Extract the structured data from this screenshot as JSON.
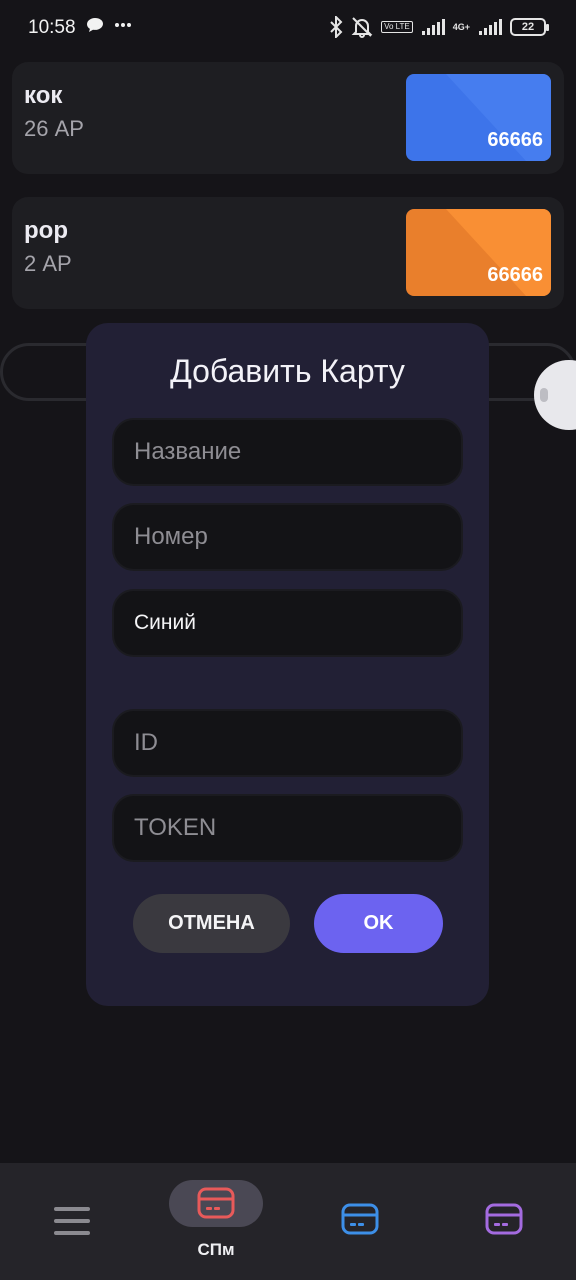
{
  "status_bar": {
    "time": "10:58",
    "network": "4G+",
    "lte": "Vo LTE",
    "battery": "22"
  },
  "cards": [
    {
      "name": "кок",
      "balance": "26 АР",
      "number": "66666",
      "color": "#3d74ea"
    },
    {
      "name": "рор",
      "balance": "2 АР",
      "number": "66666",
      "color": "#f4832f"
    }
  ],
  "dialog": {
    "title": "Добавить Карту",
    "name_placeholder": "Название",
    "number_placeholder": "Номер",
    "color_value": "Синий",
    "id_placeholder": "ID",
    "token_placeholder": "TOKEN",
    "cancel_label": "ОТМЕНА",
    "ok_label": "OK"
  },
  "bottom_nav": {
    "active_label": "СПм",
    "items": [
      {
        "icon": "menu-icon"
      },
      {
        "icon": "card-icon",
        "color": "#e85a5a"
      },
      {
        "icon": "card-icon",
        "color": "#3d8fe8"
      },
      {
        "icon": "card-icon",
        "color": "#a46be0"
      }
    ]
  }
}
